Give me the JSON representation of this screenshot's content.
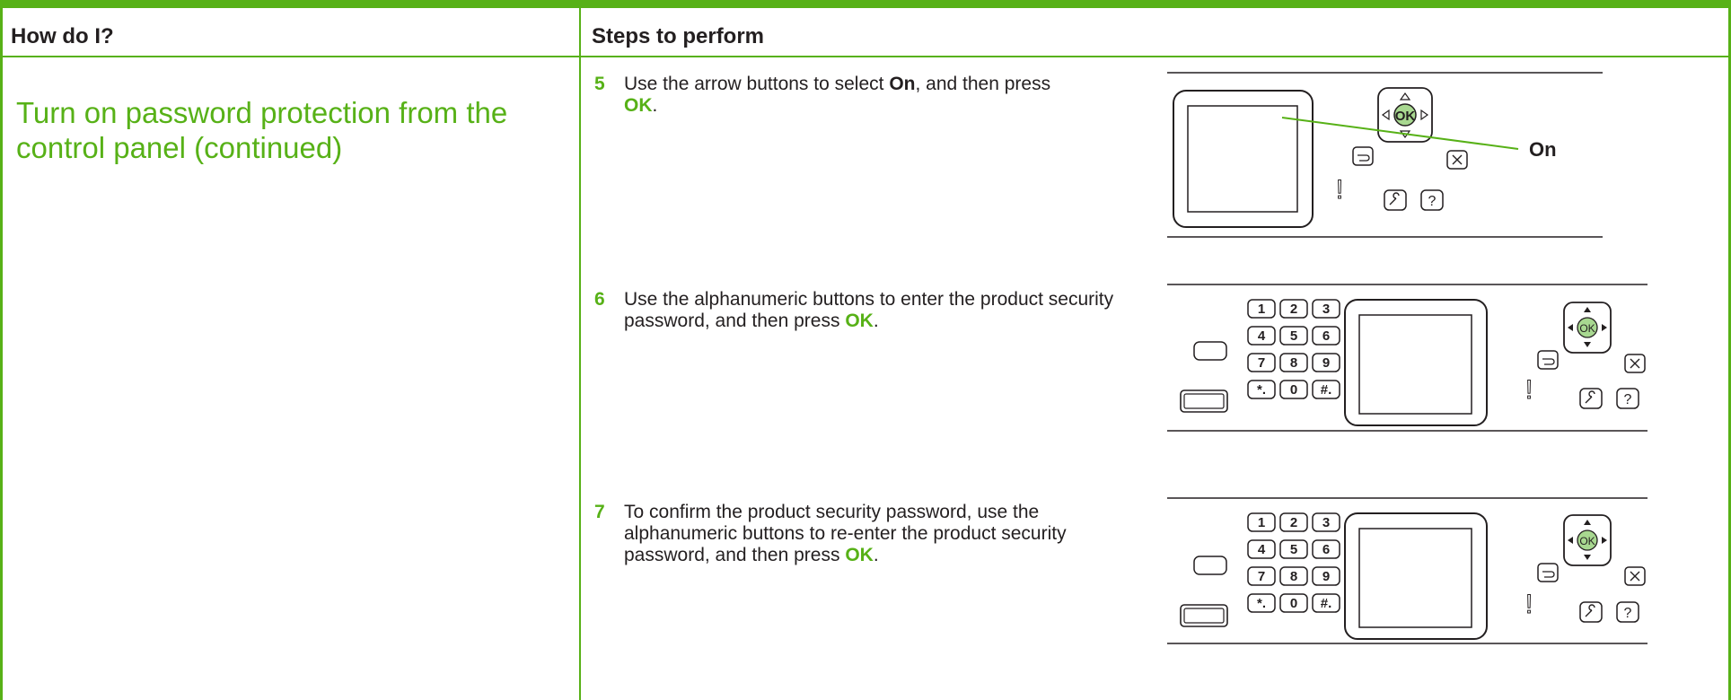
{
  "table": {
    "col1_header": "How do I?",
    "col2_header": "Steps to perform"
  },
  "question": "Turn on password protection from the control panel (continued)",
  "steps": [
    {
      "number": "5",
      "text_a": "Use the arrow buttons to select ",
      "bold_a": "On",
      "text_b": ", and then press ",
      "ok": "OK",
      "text_c": ".",
      "callout": "On"
    },
    {
      "number": "6",
      "text_a": "Use the alphanumeric buttons to enter the product security password, and then press ",
      "ok": "OK",
      "text_c": "."
    },
    {
      "number": "7",
      "text_a": "To confirm the product security password, use the alphanumeric buttons to re-enter the product security password, and then press ",
      "ok": "OK",
      "text_c": "."
    }
  ],
  "keypad": {
    "ok_label": "OK",
    "keys": [
      "1",
      "2",
      "3",
      "4",
      "5",
      "6",
      "7",
      "8",
      "9",
      "*.",
      "0",
      "#."
    ],
    "help_label": "?",
    "alert_label": "!"
  },
  "colors": {
    "accent": "#57b117",
    "text": "#231f20"
  }
}
